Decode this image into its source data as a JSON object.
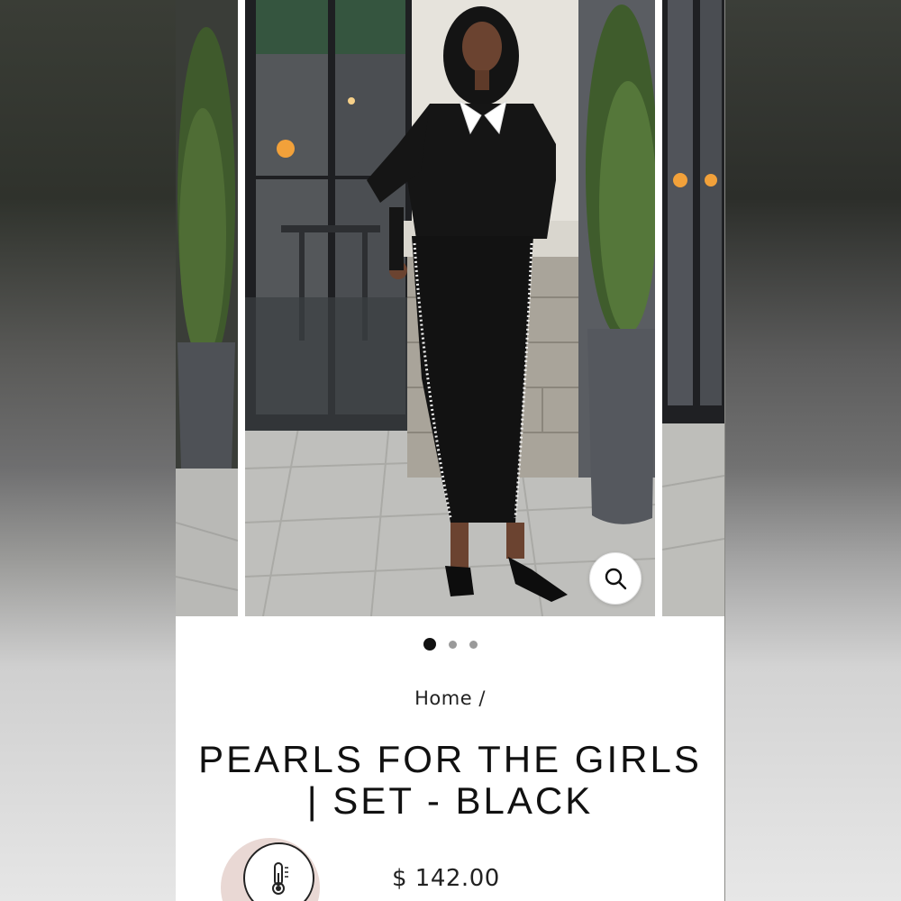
{
  "gallery": {
    "slide_count": 3,
    "active_slide": 1,
    "zoom_icon": "search-icon"
  },
  "breadcrumb": {
    "home_label": "Home",
    "separator": "/"
  },
  "product": {
    "title": "PEARLS FOR THE GIRLS | SET - BLACK",
    "price": "$ 142.00",
    "badge_icon": "thermometer-icon"
  },
  "colors": {
    "accent_badge_bg": "#e9d8d4",
    "text": "#222222",
    "dot_active": "#111111",
    "dot_inactive": "#9a9a9a"
  }
}
